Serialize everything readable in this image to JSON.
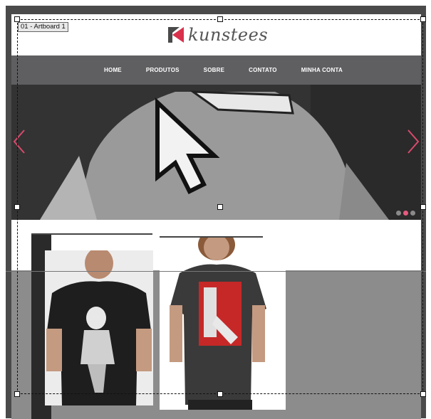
{
  "artboard": {
    "label": "01 - Artboard 1"
  },
  "logo": {
    "text": "kunstees"
  },
  "nav": {
    "items": [
      "HOME",
      "PRODUTOS",
      "SOBRE",
      "CONTATO",
      "MINHA CONTA"
    ]
  },
  "hero": {
    "prev_icon": "chevron-left-icon",
    "next_icon": "chevron-right-icon",
    "slide_count": 3,
    "active_slide": 2
  },
  "colors": {
    "nav_bg": "#5f5f62",
    "accent": "#e65a80",
    "logo_red": "#d9304c",
    "page_bg": "#4a4a4a"
  }
}
